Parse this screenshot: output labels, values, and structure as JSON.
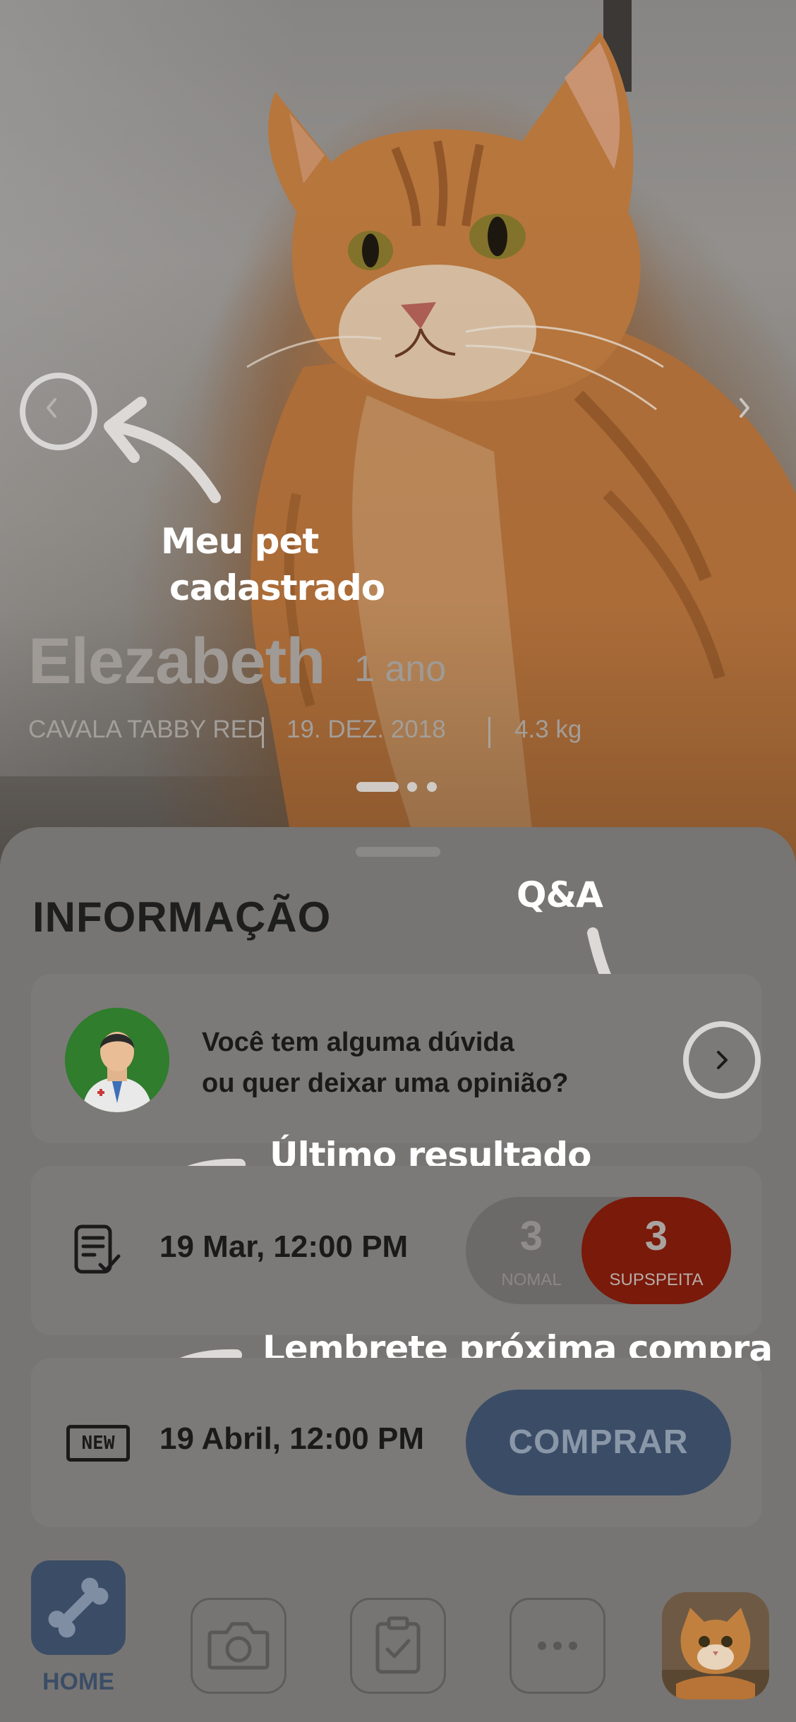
{
  "pet": {
    "name": "Elezabeth",
    "age": "1 ano",
    "breed": "CAVALA TABBY RED",
    "birth_date": "19. DEZ. 2018",
    "weight": "4.3 kg"
  },
  "carousel": {
    "active_index": 0,
    "count": 3
  },
  "annotations": {
    "pet_registered_line1": "Meu pet",
    "pet_registered_line2": "cadastrado",
    "qa": "Q&A",
    "last_result": "Último resultado",
    "next_purchase": "Lembrete próxima compra"
  },
  "info": {
    "title": "INFORMAÇÃO",
    "qa_line1": "Você tem alguma dúvida",
    "qa_line2": "ou quer deixar uma opinião?"
  },
  "result": {
    "date": "19 Mar, 12:00 PM",
    "normal_count": "3",
    "normal_label": "NOMAL",
    "suspect_count": "3",
    "suspect_label": "SUPSPEITA"
  },
  "purchase": {
    "badge": "NEW",
    "date": "19 Abril, 12:00 PM",
    "button_label": "COMPRAR"
  },
  "bottom_nav": {
    "home_label": "HOME",
    "items": [
      "bone-icon",
      "camera-icon",
      "clipboard-check-icon",
      "more-icon",
      "profile-photo"
    ]
  },
  "colors": {
    "accent": "#3b4d66",
    "suspect": "#7a1a0a",
    "avatar_bg": "#2f7d2d"
  }
}
